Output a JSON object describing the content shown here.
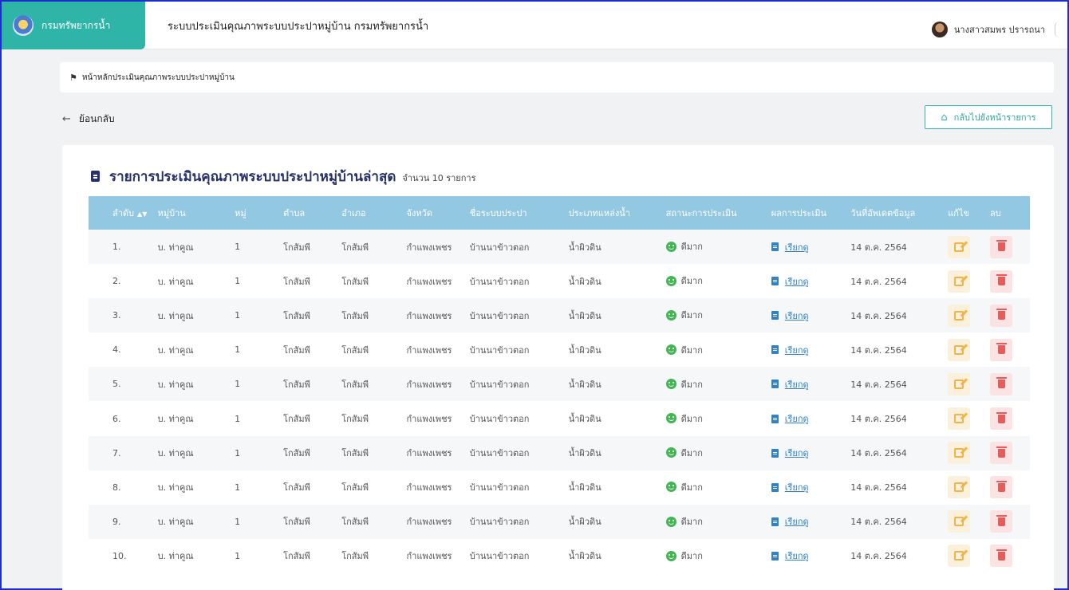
{
  "header": {
    "brand_label": "กรมทรัพยากรน้ำ",
    "app_title": "ระบบประเมินคุณภาพระบบประปาหมู่บ้าน กรมทรัพยากรน้ำ",
    "user_name": "นางสาวสมพร ปรารถนา"
  },
  "breadcrumb": {
    "label": "หน้าหลักประเมินคุณภาพระบบประปาหมู่บ้าน"
  },
  "nav": {
    "back_label": "ย้อนกลับ",
    "return_label": "กลับไปยังหน้ารายการ"
  },
  "card": {
    "title": "รายการประเมินคุณภาพระบบประปาหมู่บ้านล่าสุด",
    "count_text": "จำนวน 10 รายการ"
  },
  "table": {
    "headers": [
      "ลำดับ",
      "หมู่บ้าน",
      "หมู่",
      "ตำบล",
      "อำเภอ",
      "จังหวัด",
      "ชื่อระบบประปา",
      "ประเภทแหล่งน้ำ",
      "สถานะการประเมิน",
      "ผลการประเมิน",
      "วันที่อัพเดตข้อมูล",
      "แก้ไข",
      "ลบ"
    ],
    "rows": [
      {
        "no": "1.",
        "village": "บ. ท่าคูณ",
        "moo": "1",
        "tambon": "โกสัมพี",
        "amphoe": "โกสัมพี",
        "province": "กำแพงเพชร",
        "system": "บ้านนาข้าวตอก",
        "source": "น้ำผิวดิน",
        "status": "ดีมาก",
        "result": "เรียกดู",
        "date": "14 ต.ค. 2564"
      },
      {
        "no": "2.",
        "village": "บ. ท่าคูณ",
        "moo": "1",
        "tambon": "โกสัมพี",
        "amphoe": "โกสัมพี",
        "province": "กำแพงเพชร",
        "system": "บ้านนาข้าวตอก",
        "source": "น้ำผิวดิน",
        "status": "ดีมาก",
        "result": "เรียกดู",
        "date": "14 ต.ค. 2564"
      },
      {
        "no": "3.",
        "village": "บ. ท่าคูณ",
        "moo": "1",
        "tambon": "โกสัมพี",
        "amphoe": "โกสัมพี",
        "province": "กำแพงเพชร",
        "system": "บ้านนาข้าวตอก",
        "source": "น้ำผิวดิน",
        "status": "ดีมาก",
        "result": "เรียกดู",
        "date": "14 ต.ค. 2564"
      },
      {
        "no": "4.",
        "village": "บ. ท่าคูณ",
        "moo": "1",
        "tambon": "โกสัมพี",
        "amphoe": "โกสัมพี",
        "province": "กำแพงเพชร",
        "system": "บ้านนาข้าวตอก",
        "source": "น้ำผิวดิน",
        "status": "ดีมาก",
        "result": "เรียกดู",
        "date": "14 ต.ค. 2564"
      },
      {
        "no": "5.",
        "village": "บ. ท่าคูณ",
        "moo": "1",
        "tambon": "โกสัมพี",
        "amphoe": "โกสัมพี",
        "province": "กำแพงเพชร",
        "system": "บ้านนาข้าวตอก",
        "source": "น้ำผิวดิน",
        "status": "ดีมาก",
        "result": "เรียกดู",
        "date": "14 ต.ค. 2564"
      },
      {
        "no": "6.",
        "village": "บ. ท่าคูณ",
        "moo": "1",
        "tambon": "โกสัมพี",
        "amphoe": "โกสัมพี",
        "province": "กำแพงเพชร",
        "system": "บ้านนาข้าวตอก",
        "source": "น้ำผิวดิน",
        "status": "ดีมาก",
        "result": "เรียกดู",
        "date": "14 ต.ค. 2564"
      },
      {
        "no": "7.",
        "village": "บ. ท่าคูณ",
        "moo": "1",
        "tambon": "โกสัมพี",
        "amphoe": "โกสัมพี",
        "province": "กำแพงเพชร",
        "system": "บ้านนาข้าวตอก",
        "source": "น้ำผิวดิน",
        "status": "ดีมาก",
        "result": "เรียกดู",
        "date": "14 ต.ค. 2564"
      },
      {
        "no": "8.",
        "village": "บ. ท่าคูณ",
        "moo": "1",
        "tambon": "โกสัมพี",
        "amphoe": "โกสัมพี",
        "province": "กำแพงเพชร",
        "system": "บ้านนาข้าวตอก",
        "source": "น้ำผิวดิน",
        "status": "ดีมาก",
        "result": "เรียกดู",
        "date": "14 ต.ค. 2564"
      },
      {
        "no": "9.",
        "village": "บ. ท่าคูณ",
        "moo": "1",
        "tambon": "โกสัมพี",
        "amphoe": "โกสัมพี",
        "province": "กำแพงเพชร",
        "system": "บ้านนาข้าวตอก",
        "source": "น้ำผิวดิน",
        "status": "ดีมาก",
        "result": "เรียกดู",
        "date": "14 ต.ค. 2564"
      },
      {
        "no": "10.",
        "village": "บ. ท่าคูณ",
        "moo": "1",
        "tambon": "โกสัมพี",
        "amphoe": "โกสัมพี",
        "province": "กำแพงเพชร",
        "system": "บ้านนาข้าวตอก",
        "source": "น้ำผิวดิน",
        "status": "ดีมาก",
        "result": "เรียกดู",
        "date": "14 ต.ค. 2564"
      }
    ]
  },
  "icons": {
    "logo": "department-logo-icon",
    "home": "home-icon",
    "back": "arrow-left-icon",
    "return": "house-icon",
    "clipboard": "clipboard-icon",
    "sort": "sort-icon",
    "status": "smile-icon",
    "result": "document-icon",
    "edit": "edit-icon",
    "delete": "trash-icon"
  },
  "colors": {
    "brand": "#2fb5a8",
    "table_header": "#93c8e3",
    "title": "#26306a",
    "status_good": "#43b554",
    "link": "#2f82c6",
    "edit": "#f1b44a",
    "delete": "#e85b5b"
  }
}
